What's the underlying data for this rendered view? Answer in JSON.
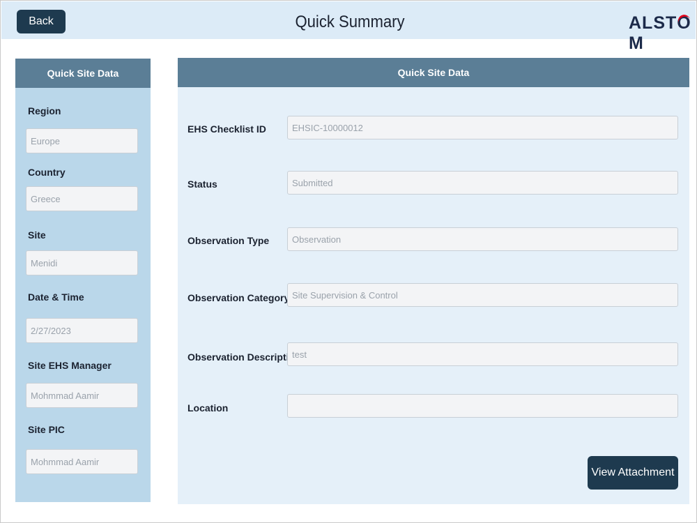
{
  "header": {
    "back_label": "Back",
    "title": "Quick Summary",
    "logo_text_left": "ALST",
    "logo_text_o": "O",
    "logo_text_right": "M",
    "brand_accent": "#e2001a"
  },
  "left_panel": {
    "title": "Quick Site Data",
    "fields": [
      {
        "label": "Region",
        "value": "Europe"
      },
      {
        "label": "Country",
        "value": "Greece"
      },
      {
        "label": "Site",
        "value": "Menidi"
      },
      {
        "label": "Date & Time",
        "value": "2/27/2023"
      },
      {
        "label": "Site EHS Manager",
        "value": "Mohmmad Aamir"
      },
      {
        "label": "Site PIC",
        "value": "Mohmmad Aamir"
      }
    ]
  },
  "right_panel": {
    "title": "Quick Site Data",
    "fields": [
      {
        "label": "EHS Checklist ID",
        "value": "EHSIC-10000012"
      },
      {
        "label": "Status",
        "value": "Submitted"
      },
      {
        "label": "Observation Type",
        "value": "Observation"
      },
      {
        "label": "Observation Category",
        "value": "Site Supervision & Control"
      },
      {
        "label": "Observation Description",
        "value": "test"
      },
      {
        "label": "Location",
        "value": ""
      }
    ],
    "attachment_button_label": "View Attachment"
  },
  "colors": {
    "header_bg": "#dcebf7",
    "panel_head_bg": "#5b7e96",
    "left_panel_bg": "#bad7ea",
    "right_panel_bg": "#e5f0f9",
    "button_bg": "#1e3a4f"
  }
}
